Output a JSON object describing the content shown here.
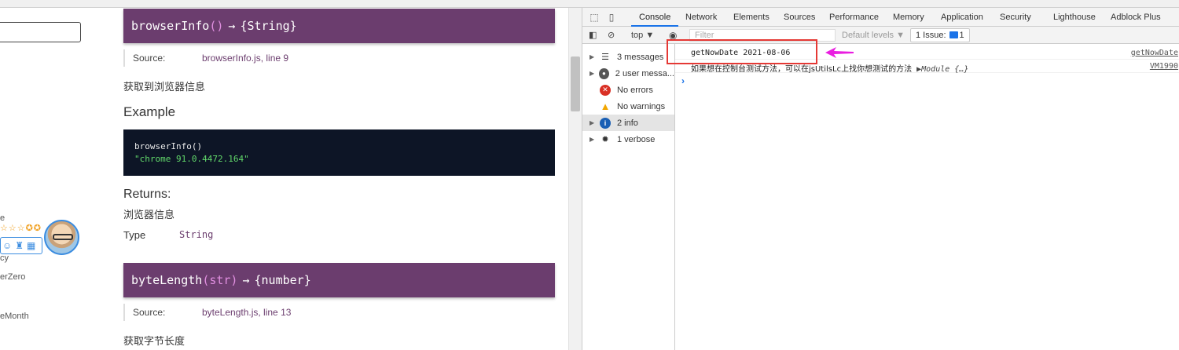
{
  "sidebar": {
    "frag_e": "e",
    "stars": "☆☆☆✪✪",
    "frag_cy": "cy",
    "frag_zero": "erZero",
    "frag_month": "eMonth"
  },
  "docs": {
    "section1": {
      "name": "browserInfo",
      "params": "()",
      "arrow": "→",
      "returns": "{String}",
      "source_label": "Source:",
      "source_link": "browserInfo.js, line 9",
      "description": "获取到浏览器信息",
      "example_heading": "Example",
      "code_line1": "browserInfo()",
      "code_line2": "\"chrome 91.0.4472.164\"",
      "returns_heading": "Returns:",
      "returns_desc": "浏览器信息",
      "type_label": "Type",
      "type_value": "String"
    },
    "section2": {
      "name": "byteLength",
      "params": "(str)",
      "arrow": "→",
      "returns": "{number}",
      "source_label": "Source:",
      "source_link": "byteLength.js, line 13",
      "description": "获取字节长度"
    }
  },
  "devtools": {
    "tabs": [
      "Console",
      "Network",
      "Elements",
      "Sources",
      "Performance",
      "Memory",
      "Application",
      "Security",
      "Lighthouse",
      "Adblock Plus"
    ],
    "active_tab": "Console",
    "toolbar": {
      "context": "top ▼",
      "filter_placeholder": "Filter",
      "levels": "Default levels ▼",
      "issues": "1 Issue:",
      "issues_count": "1"
    },
    "sidebar_items": [
      {
        "label": "3 messages",
        "icon": "list-icon"
      },
      {
        "label": "2 user messa...",
        "icon": "user-icon"
      },
      {
        "label": "No errors",
        "icon": "error-icon"
      },
      {
        "label": "No warnings",
        "icon": "warning-icon"
      },
      {
        "label": "2 info",
        "icon": "info-icon"
      },
      {
        "label": "1 verbose",
        "icon": "verbose-icon"
      }
    ],
    "logs": [
      {
        "message": "getNowDate 2021-08-06",
        "source": "getNowDate"
      },
      {
        "message": "如果想在控制台测试方法，可以在jsUtilsLc上找你想测试的方法",
        "module": "▶Module {…}",
        "source": "VM1990"
      }
    ],
    "prompt": "›"
  },
  "colors": {
    "doc_header_bg": "#6b3d6e",
    "code_bg": "#0d1526",
    "highlight": "#e53935",
    "arrow": "#e91ee0",
    "devtools_accent": "#1a73e8"
  }
}
